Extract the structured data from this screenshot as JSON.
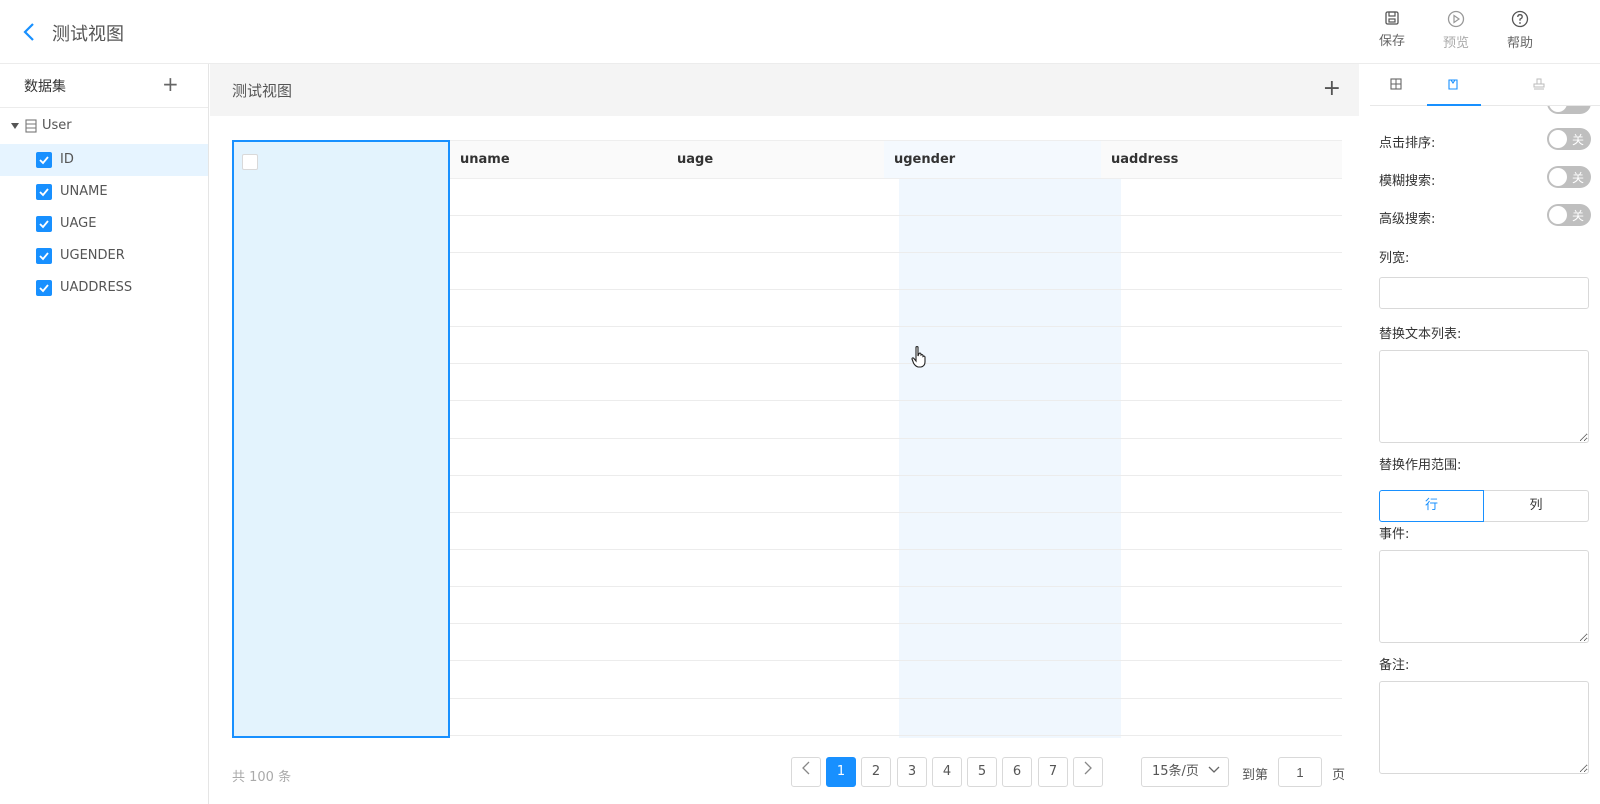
{
  "header": {
    "title": "测试视图",
    "buttons": {
      "save": "保存",
      "preview": "预览",
      "help": "帮助"
    }
  },
  "sidebar": {
    "title": "数据集",
    "root": {
      "label": "User",
      "icon": "table-icon"
    },
    "items": [
      {
        "label": "ID",
        "checked": true,
        "selected": true
      },
      {
        "label": "UNAME",
        "checked": true
      },
      {
        "label": "UAGE",
        "checked": true
      },
      {
        "label": "UGENDER",
        "checked": true
      },
      {
        "label": "UADDRESS",
        "checked": true
      }
    ]
  },
  "main": {
    "title": "测试视图",
    "columns": [
      "",
      "uname",
      "uage",
      "ugender",
      "uaddress"
    ],
    "total": "共 100 条",
    "pagination": {
      "pages": [
        "1",
        "2",
        "3",
        "4",
        "5",
        "6",
        "7"
      ],
      "current": "1",
      "page_size": "15条/页",
      "goto_label": "到第",
      "goto_value": "1",
      "goto_suffix": "页"
    }
  },
  "right_panel": {
    "tabs": [
      {
        "icon": "table-icon",
        "active": false
      },
      {
        "icon": "tag-icon",
        "active": true
      },
      {
        "icon": "stamp-icon",
        "active": false
      }
    ],
    "toggles": [
      {
        "label": "点击排序:",
        "state": "关"
      },
      {
        "label": "模糊搜索:",
        "state": "关"
      },
      {
        "label": "高级搜索:",
        "state": "关"
      }
    ],
    "col_width_label": "列宽:",
    "replace_text_label": "替换文本列表:",
    "replace_scope_label": "替换作用范围:",
    "scope_options": [
      "行",
      "列"
    ],
    "scope_selected": "行",
    "event_label": "事件:",
    "note_label": "备注:"
  },
  "colors": {
    "accent": "#1890ff",
    "selected_bg": "#e3f3fd",
    "header_bg": "#f4f4f4"
  }
}
